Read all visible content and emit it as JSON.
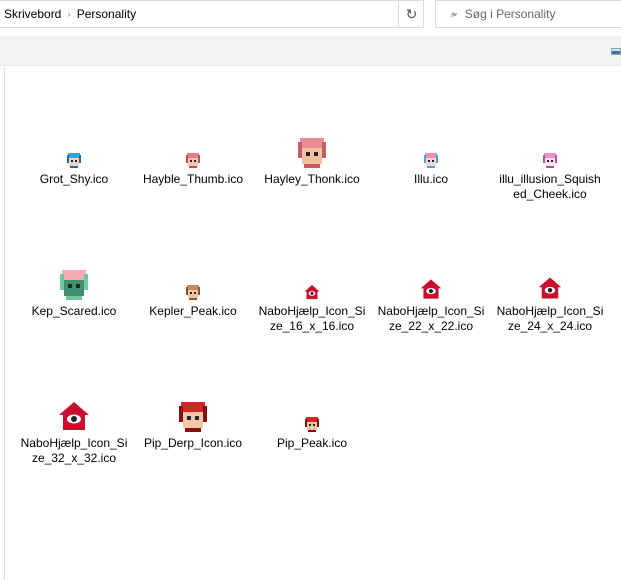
{
  "breadcrumb": [
    "Skrivebord",
    "Personality"
  ],
  "search": {
    "placeholder": "Søg i Personality"
  },
  "files": [
    {
      "name": "Grot_Shy.ico",
      "icon": "blue-hair-character-icon",
      "size": 16,
      "colors": [
        "#3aa0d8",
        "#1f6fb0",
        "#f2d2c0"
      ]
    },
    {
      "name": "Hayble_Thumb.ico",
      "icon": "pink-hair-character-icon",
      "size": 16,
      "colors": [
        "#e8788f",
        "#c04a60",
        "#f2c6a8"
      ]
    },
    {
      "name": "Hayley_Thonk.ico",
      "icon": "pink-hair-character-icon",
      "size": 32,
      "colors": [
        "#e98b98",
        "#c45a6a",
        "#f0c09c"
      ]
    },
    {
      "name": "Illu.ico",
      "icon": "pink-cat-character-icon",
      "size": 16,
      "colors": [
        "#f08fb0",
        "#45a8d8",
        "#f6d6d6"
      ]
    },
    {
      "name": "illu_illusion_Squished_Cheek.ico",
      "icon": "pink-hair-character-icon",
      "size": 16,
      "colors": [
        "#f090c8",
        "#c05090",
        "#fbe3ec"
      ]
    },
    {
      "name": "Kep_Scared.ico",
      "icon": "green-character-icon",
      "size": 32,
      "colors": [
        "#f5a8b0",
        "#6fc9a0",
        "#3f8f6f"
      ]
    },
    {
      "name": "Kepler_Peak.ico",
      "icon": "brown-hair-character-icon",
      "size": 16,
      "colors": [
        "#c88a60",
        "#8a5430",
        "#f2c6a8"
      ]
    },
    {
      "name": "NaboHjælp_Icon_Size_16_x_16.ico",
      "icon": "red-house-eye-icon",
      "size": 16,
      "colors": [
        "#c8102e"
      ]
    },
    {
      "name": "NaboHjælp_Icon_Size_22_x_22.ico",
      "icon": "red-house-eye-icon",
      "size": 22,
      "colors": [
        "#c8102e"
      ]
    },
    {
      "name": "NaboHjælp_Icon_Size_24_x_24.ico",
      "icon": "red-house-eye-icon",
      "size": 24,
      "colors": [
        "#c8102e"
      ]
    },
    {
      "name": "NaboHjælp_Icon_Size_32_x_32.ico",
      "icon": "red-house-eye-icon",
      "size": 32,
      "colors": [
        "#c8102e"
      ]
    },
    {
      "name": "Pip_Derp_Icon.ico",
      "icon": "red-hair-character-icon",
      "size": 32,
      "colors": [
        "#d02828",
        "#8a1010",
        "#f2c6a8"
      ]
    },
    {
      "name": "Pip_Peak.ico",
      "icon": "red-hair-character-icon",
      "size": 16,
      "colors": [
        "#d02828",
        "#8a1010",
        "#f2c6a8"
      ]
    }
  ]
}
